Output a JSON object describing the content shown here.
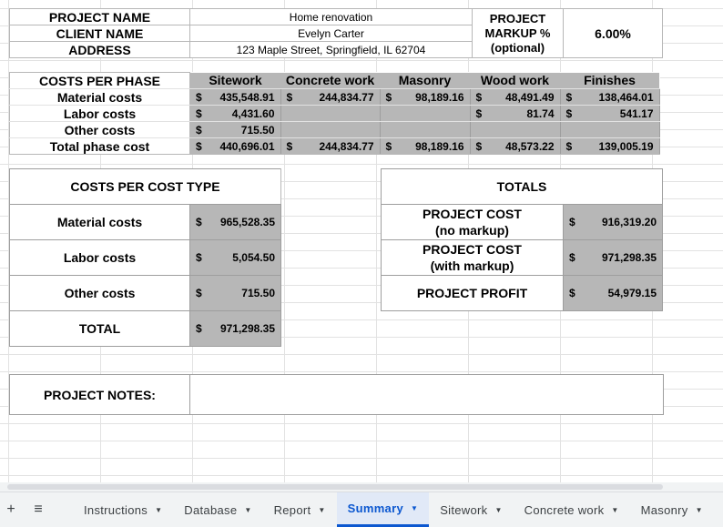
{
  "info": {
    "project_name_label": "PROJECT NAME",
    "project_name": "Home renovation",
    "client_name_label": "CLIENT NAME",
    "client_name": "Evelyn Carter",
    "address_label": "ADDRESS",
    "address": "123 Maple Street, Springfield, IL 62704",
    "markup_label_1": "PROJECT",
    "markup_label_2": "MARKUP %",
    "markup_label_3": "(optional)",
    "markup_value": "6.00%"
  },
  "phase": {
    "header_label": "COSTS PER PHASE",
    "columns": [
      "Sitework",
      "Concrete work",
      "Masonry",
      "Wood work",
      "Finishes"
    ],
    "currency": "$",
    "rows": [
      {
        "label": "Material costs",
        "values": [
          "435,548.91",
          "244,834.77",
          "98,189.16",
          "48,491.49",
          "138,464.01"
        ]
      },
      {
        "label": "Labor costs",
        "values": [
          "4,431.60",
          "",
          "",
          "81.74",
          "541.17"
        ]
      },
      {
        "label": "Other costs",
        "values": [
          "715.50",
          "",
          "",
          "",
          ""
        ]
      },
      {
        "label": "Total phase cost",
        "values": [
          "440,696.01",
          "244,834.77",
          "98,189.16",
          "48,573.22",
          "139,005.19"
        ]
      }
    ]
  },
  "types": {
    "header": "COSTS PER COST TYPE",
    "rows": [
      {
        "label": "Material costs",
        "value": "965,528.35"
      },
      {
        "label": "Labor costs",
        "value": "5,054.50"
      },
      {
        "label": "Other costs",
        "value": "715.50"
      },
      {
        "label": "TOTAL",
        "value": "971,298.35"
      }
    ]
  },
  "totals": {
    "header": "TOTALS",
    "rows": [
      {
        "label": "PROJECT COST",
        "sub": "(no markup)",
        "value": "916,319.20"
      },
      {
        "label": "PROJECT COST",
        "sub": "(with markup)",
        "value": "971,298.35"
      },
      {
        "label": "PROJECT PROFIT",
        "sub": "",
        "value": "54,979.15"
      }
    ]
  },
  "notes": {
    "label": "PROJECT NOTES:",
    "value": ""
  },
  "tabs": {
    "add_icon": "+",
    "menu_icon": "≡",
    "items": [
      {
        "label": "Instructions"
      },
      {
        "label": "Database"
      },
      {
        "label": "Report"
      },
      {
        "label": "Summary"
      },
      {
        "label": "Sitework"
      },
      {
        "label": "Concrete work"
      },
      {
        "label": "Masonry"
      }
    ],
    "active": "Summary",
    "arrow": "▼"
  }
}
